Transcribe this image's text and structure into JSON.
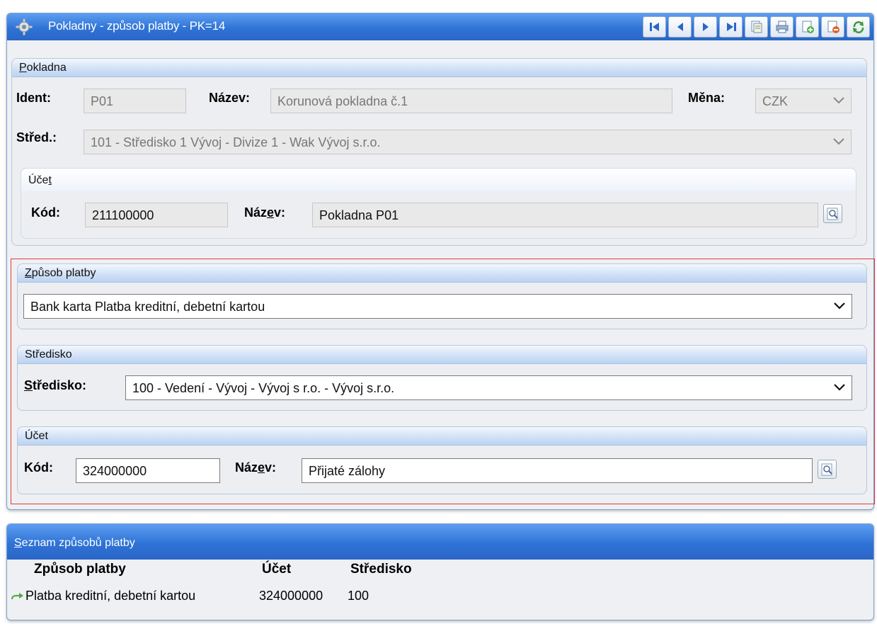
{
  "window": {
    "title": "Pokladny - způsob platby - PK=14",
    "toolbar_icons": [
      "first-record-icon",
      "previous-record-icon",
      "next-record-icon",
      "last-record-icon",
      "copy-record-icon",
      "print-icon",
      "add-record-icon",
      "delete-record-icon",
      "refresh-icon"
    ]
  },
  "pokladna": {
    "header_pre": "P",
    "header_rest": "okladna",
    "ident_label": "Ident:",
    "ident_value": "P01",
    "nazev_label": "Název:",
    "nazev_value": "Korunová pokladna č.1",
    "mena_label": "Měna:",
    "mena_value": "CZK",
    "stred_label": "Střed.:",
    "stred_value": "101 - Středisko 1 Vývoj - Divize 1 - Wak Vývoj s.r.o.",
    "ucet": {
      "header_pre": "Úče",
      "header_u": "t",
      "kod_label": "Kód:",
      "kod_value": "211100000",
      "nazev_label_pre": "Náz",
      "nazev_label_u": "e",
      "nazev_label_post": "v:",
      "nazev_value": "Pokladna P01"
    }
  },
  "zpusob": {
    "header_u": "Z",
    "header_rest": "působ platby",
    "value": "Bank karta Platba kreditní, debetní kartou"
  },
  "stredisko": {
    "header": "Středisko",
    "label_u": "S",
    "label_rest": "tředisko:",
    "value": "100 - Vedení - Vývoj - Vývoj s r.o. - Vývoj s.r.o."
  },
  "ucet2": {
    "header": "Účet",
    "kod_label": "Kód:",
    "kod_value": "324000000",
    "nazev_label_pre": "Náz",
    "nazev_label_u": "e",
    "nazev_label_post": "v:",
    "nazev_value": "Přijaté zálohy"
  },
  "list": {
    "header_u": "S",
    "header_rest": "eznam způsobů platby",
    "columns": [
      "Způsob platby",
      "Účet",
      "Středisko"
    ],
    "rows": [
      {
        "zpusob": "Platba kreditní, debetní kartou",
        "ucet": "324000000",
        "stredisko": "100"
      }
    ]
  },
  "colors": {
    "title_blue": "#2f73d6",
    "highlight_red": "#e23a3a"
  }
}
